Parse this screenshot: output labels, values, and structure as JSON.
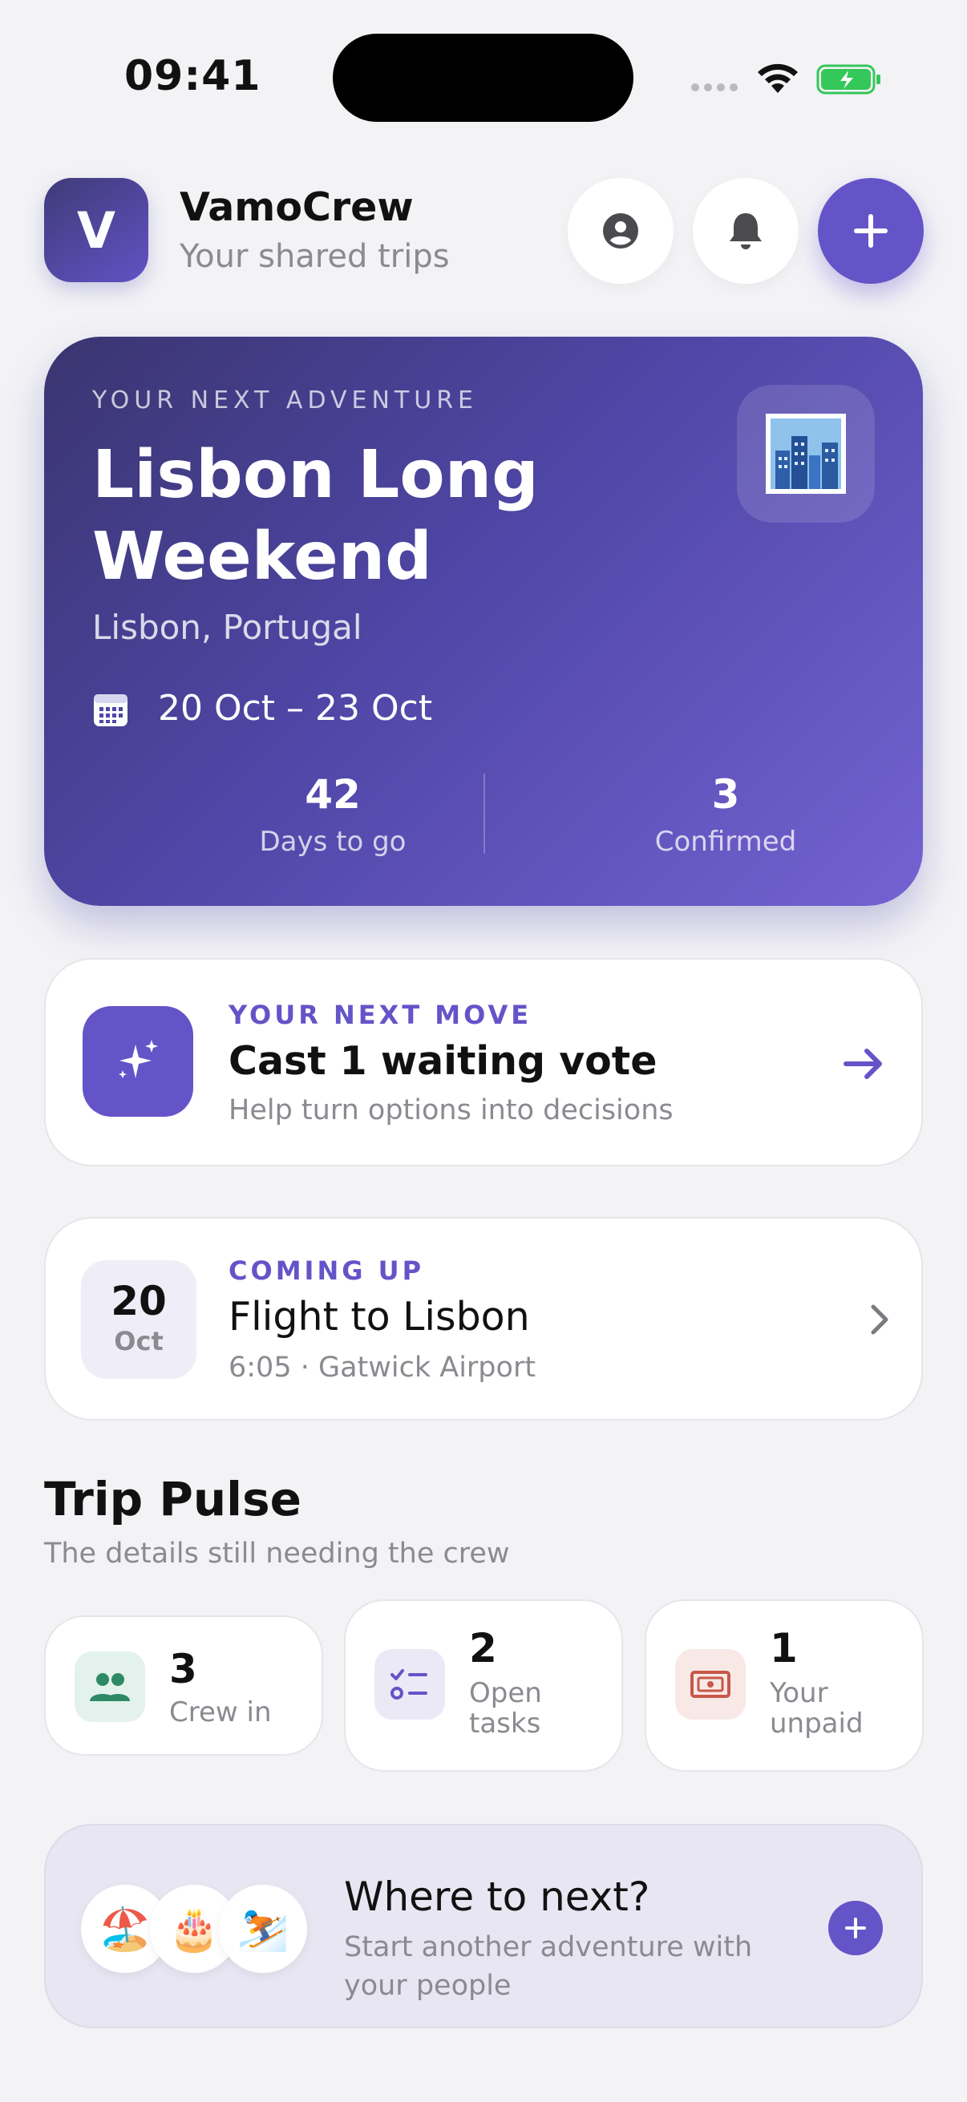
{
  "status_bar": {
    "time": "09:41"
  },
  "header": {
    "logo_letter": "V",
    "app_name": "VamoCrew",
    "subtitle": "Your shared trips",
    "icons": [
      "profile-icon",
      "bell-icon",
      "plus-icon"
    ]
  },
  "hero": {
    "eyebrow": "YOUR NEXT ADVENTURE",
    "title": "Lisbon Long Weekend",
    "location": "Lisbon, Portugal",
    "dates": "20 Oct – 23 Oct",
    "photo_emoji": "🏙️",
    "stats": [
      {
        "value": "42",
        "label": "Days to go"
      },
      {
        "value": "3",
        "label": "Confirmed"
      }
    ]
  },
  "next_move": {
    "eyebrow": "YOUR NEXT MOVE",
    "title": "Cast 1 waiting vote",
    "subtitle": "Help turn options into decisions"
  },
  "coming_up": {
    "eyebrow": "COMING UP",
    "day": "20",
    "month": "Oct",
    "title": "Flight to Lisbon",
    "subtitle": "6:05 · Gatwick Airport"
  },
  "trip_pulse": {
    "title": "Trip Pulse",
    "subtitle": "The details still needing the crew",
    "cards": [
      {
        "value": "3",
        "label": "Crew in",
        "icon": "people-icon",
        "color": "#2e8a66"
      },
      {
        "value": "2",
        "label": "Open tasks",
        "icon": "checklist-icon",
        "color": "#6454c8"
      },
      {
        "value": "1",
        "label": "Your unpaid",
        "icon": "cash-icon",
        "color": "#c8584a"
      }
    ]
  },
  "where_next": {
    "emojis": [
      "🏖️",
      "🎂",
      "⛷️"
    ],
    "title": "Where to next?",
    "subtitle": "Start another adventure with your people"
  },
  "colors": {
    "accent": "#6454c8",
    "background": "#f3f3f6"
  }
}
